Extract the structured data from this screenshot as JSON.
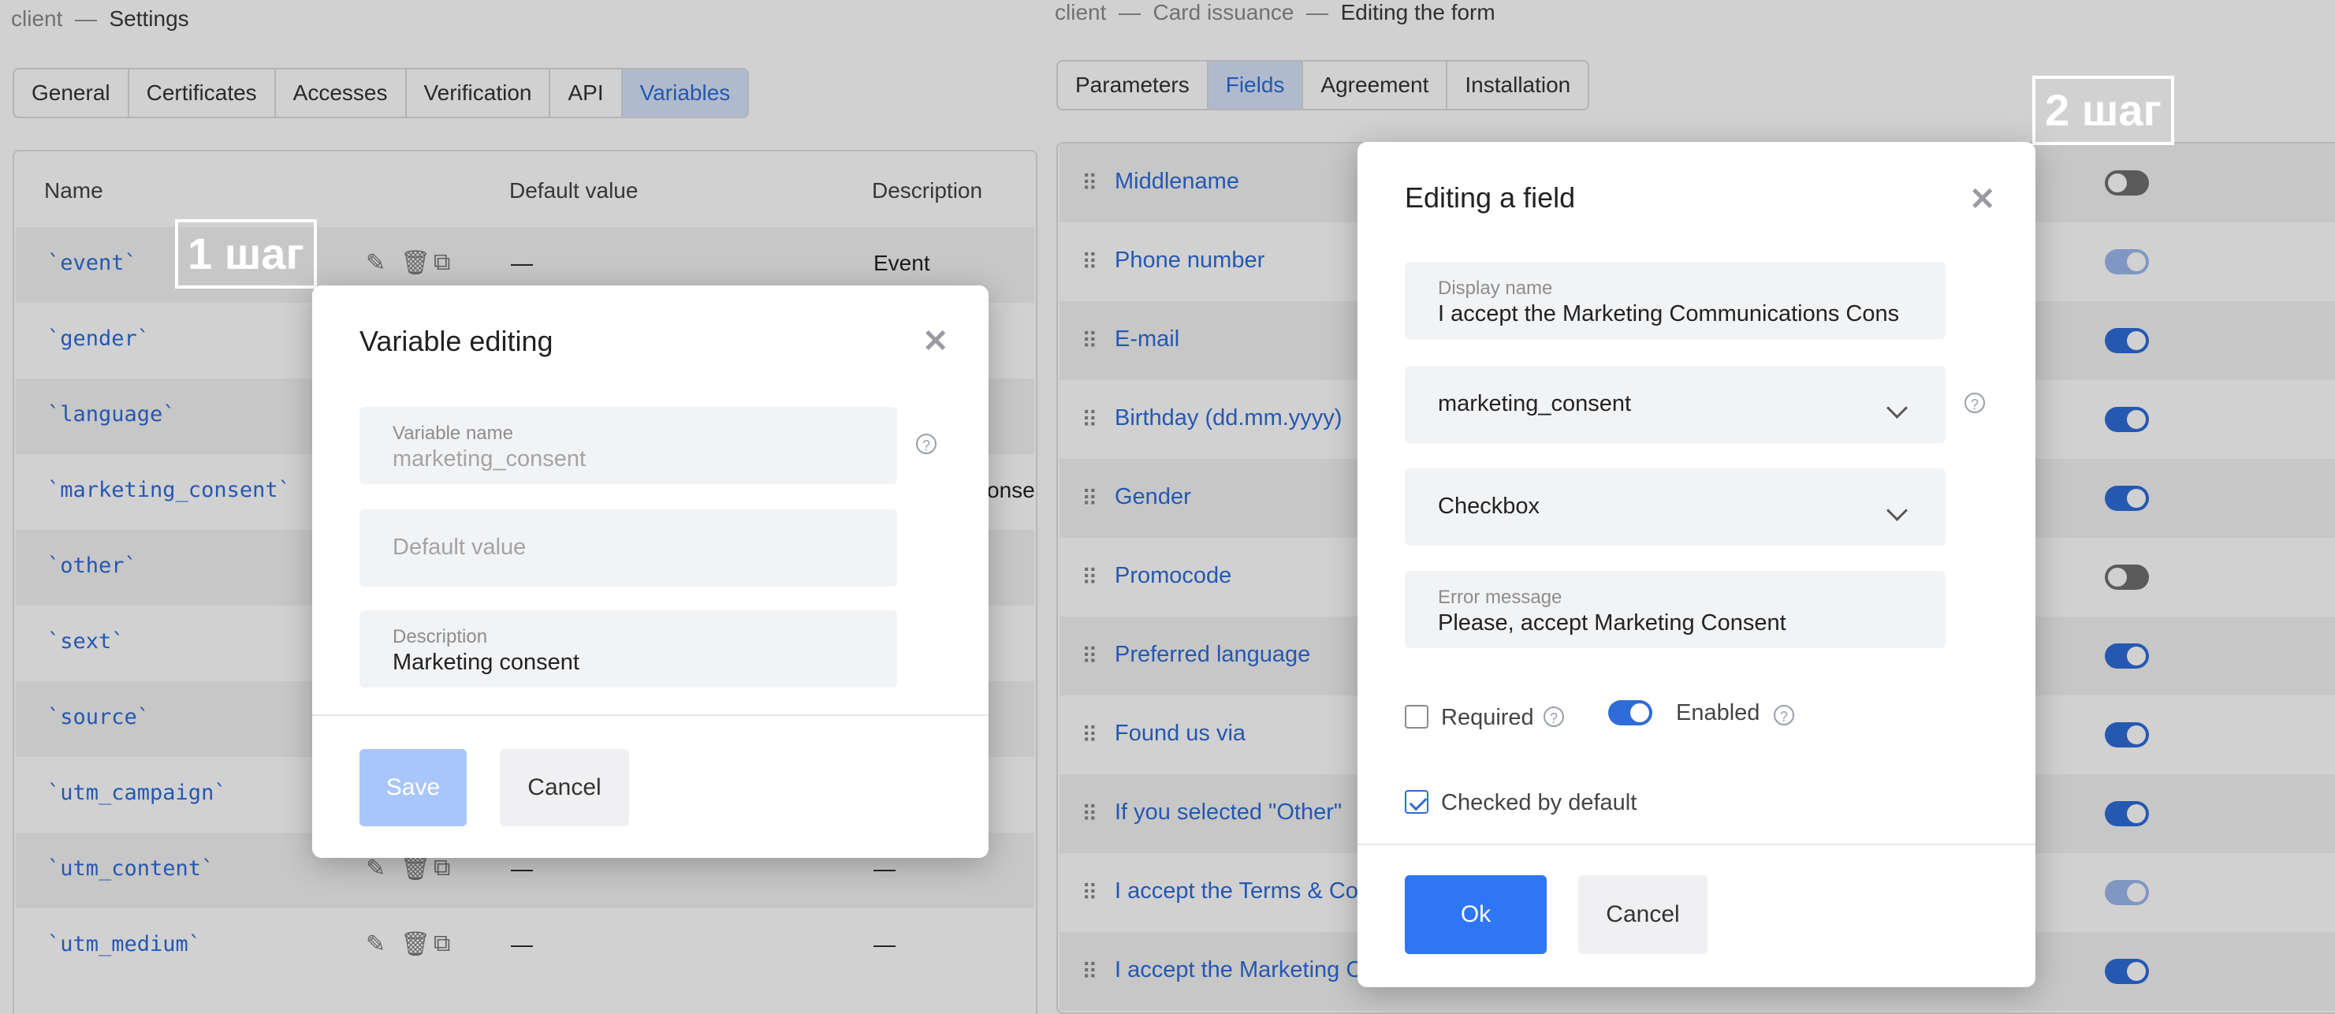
{
  "left": {
    "breadcrumb": {
      "app": "client",
      "sep": "—",
      "page": "Settings"
    },
    "tabs": [
      "General",
      "Certificates",
      "Accesses",
      "Verification",
      "API",
      "Variables"
    ],
    "table": {
      "headers": {
        "name": "Name",
        "default": "Default value",
        "description": "Description"
      },
      "rows": [
        {
          "name": "`event`",
          "default": "—",
          "description": "Event"
        },
        {
          "name": "`gender`",
          "default": "",
          "description": ""
        },
        {
          "name": "`language`",
          "default": "",
          "description": ""
        },
        {
          "name": "`marketing_consent`",
          "default": "",
          "description": "onse"
        },
        {
          "name": "`other`",
          "default": "",
          "description": ""
        },
        {
          "name": "`sext`",
          "default": "",
          "description": ""
        },
        {
          "name": "`source`",
          "default": "",
          "description": ""
        },
        {
          "name": "`utm_campaign`",
          "default": "",
          "description": ""
        },
        {
          "name": "`utm_content`",
          "default": "—",
          "description": "—"
        },
        {
          "name": "`utm_medium`",
          "default": "—",
          "description": "—"
        }
      ]
    },
    "step_label": "1 шаг",
    "modal": {
      "title": "Variable editing",
      "variable_name_label": "Variable name",
      "variable_name_value": "marketing_consent",
      "default_value_placeholder": "Default value",
      "description_label": "Description",
      "description_value": "Marketing consent",
      "save": "Save",
      "cancel": "Cancel"
    }
  },
  "right": {
    "breadcrumb": {
      "app": "client",
      "sep1": "—",
      "section": "Card issuance",
      "sep2": "—",
      "page": "Editing the form"
    },
    "tabs": [
      "Parameters",
      "Fields",
      "Agreement",
      "Installation"
    ],
    "step_label": "2 шаг",
    "fields": [
      {
        "name": "Middlename",
        "toggle": "off"
      },
      {
        "name": "Phone number",
        "toggle": "disabled"
      },
      {
        "name": "E-mail",
        "toggle": "on"
      },
      {
        "name": "Birthday (dd.mm.yyyy)",
        "toggle": "on"
      },
      {
        "name": "Gender",
        "toggle": "on"
      },
      {
        "name": "Promocode",
        "toggle": "off"
      },
      {
        "name": "Preferred language",
        "toggle": "on"
      },
      {
        "name": "Found us via",
        "toggle": "on"
      },
      {
        "name": "If you selected \"Other\"",
        "toggle": "on"
      },
      {
        "name": "I accept the Terms & Co",
        "toggle": "disabled"
      },
      {
        "name": "I accept the Marketing C",
        "toggle": "on"
      }
    ],
    "modal": {
      "title": "Editing a field",
      "display_name_label": "Display name",
      "display_name_value": "I accept the Marketing Communications Cons",
      "variable_select": "marketing_consent",
      "type_select": "Checkbox",
      "error_label": "Error message",
      "error_value": "Please, accept Marketing Consent",
      "required_label": "Required",
      "enabled_label": "Enabled",
      "checked_default_label": "Checked by default",
      "ok": "Ok",
      "cancel": "Cancel"
    }
  },
  "colors": {
    "accent": "#2e6cd8",
    "primary_button": "#2f76f6"
  }
}
